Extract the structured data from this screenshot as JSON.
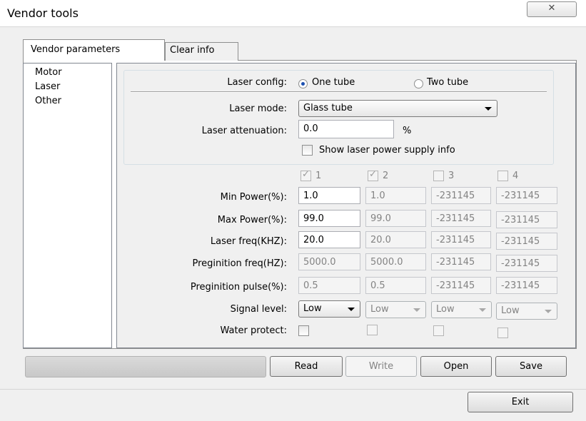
{
  "window": {
    "title": "Vendor tools",
    "close_glyph": "✕"
  },
  "tabs": {
    "vendor_parameters": "Vendor parameters",
    "clear_info": "Clear info"
  },
  "nav": {
    "items": [
      "Motor",
      "Laser",
      "Other"
    ]
  },
  "laser_config": {
    "label": "Laser config:",
    "options": [
      "One tube",
      "Two tube"
    ],
    "selected": "One tube"
  },
  "laser_mode": {
    "label": "Laser mode:",
    "value": "Glass tube"
  },
  "laser_attenuation": {
    "label": "Laser attenuation:",
    "value": "0.0",
    "unit": "%"
  },
  "show_psu": {
    "label": "Show laser power supply info",
    "checked": false
  },
  "columns": [
    {
      "label": "1",
      "checked": true
    },
    {
      "label": "2",
      "checked": true
    },
    {
      "label": "3",
      "checked": false
    },
    {
      "label": "4",
      "checked": false
    }
  ],
  "rows": [
    {
      "label": "Min Power(%):",
      "values": [
        "1.0",
        "1.0",
        "-231145",
        "-231145"
      ]
    },
    {
      "label": "Max Power(%):",
      "values": [
        "99.0",
        "99.0",
        "-231145",
        "-231145"
      ]
    },
    {
      "label": "Laser freq(KHZ):",
      "values": [
        "20.0",
        "20.0",
        "-231145",
        "-231145"
      ]
    },
    {
      "label": "Preginition freq(HZ):",
      "values": [
        "5000.0",
        "5000.0",
        "-231145",
        "-231145"
      ]
    },
    {
      "label": "Preginition pulse(%):",
      "values": [
        "0.5",
        "0.5",
        "-231145",
        "-231145"
      ]
    }
  ],
  "signal_level": {
    "label": "Signal level:",
    "values": [
      "Low",
      "Low",
      "Low",
      "Low"
    ]
  },
  "water_protect": {
    "label": "Water protect:"
  },
  "buttons": {
    "read": "Read",
    "write": "Write",
    "open": "Open",
    "save": "Save",
    "exit": "Exit"
  }
}
